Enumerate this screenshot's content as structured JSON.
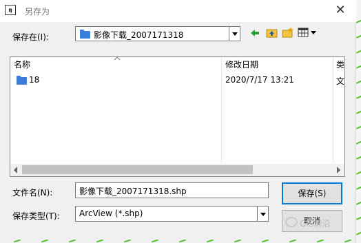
{
  "window": {
    "title": "另存为",
    "close_glyph": "✕",
    "icon_text": "ɱ"
  },
  "save_in": {
    "label": "保存在(I):",
    "value": "影像下载_2007171318"
  },
  "toolbar": {
    "icons": [
      "back-arrow-icon",
      "up-folder-icon",
      "new-folder-icon",
      "view-menu-icon"
    ]
  },
  "file_list": {
    "columns": [
      {
        "label": "名称"
      },
      {
        "label": "修改日期"
      },
      {
        "label": "类"
      }
    ],
    "rows": [
      {
        "name": "18",
        "modified": "2020/7/17 13:21",
        "type": "文"
      }
    ]
  },
  "filename": {
    "label": "文件名(N):",
    "value": "影像下载_2007171318.shp"
  },
  "filetype": {
    "label": "保存类型(T):",
    "value": "ArcView (*.shp)"
  },
  "buttons": {
    "save": "保存(S)",
    "cancel": "取消"
  },
  "watermark": {
    "text": "GIS前沿"
  },
  "colors": {
    "accent": "#0078d7",
    "folder": "#3b7ddd",
    "background": "#f0f0f0",
    "side_lines": "#52c02b"
  }
}
